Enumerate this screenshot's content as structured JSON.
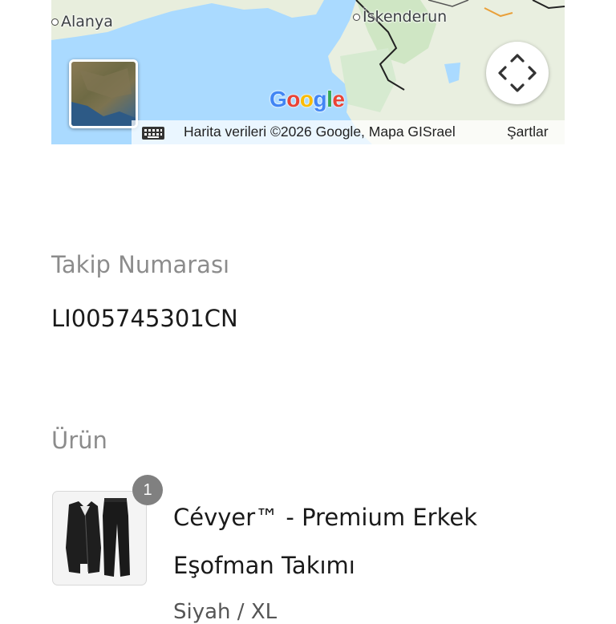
{
  "map": {
    "places": [
      "Alanya",
      "İskenderun"
    ],
    "google_logo_letters": [
      {
        "ch": "G",
        "color": "#4285F4"
      },
      {
        "ch": "o",
        "color": "#EA4335"
      },
      {
        "ch": "o",
        "color": "#FBBC05"
      },
      {
        "ch": "g",
        "color": "#4285F4"
      },
      {
        "ch": "l",
        "color": "#34A853"
      },
      {
        "ch": "e",
        "color": "#EA4335"
      }
    ],
    "attribution": "Harita verileri ©2026 Google, Mapa GISrael",
    "terms": "Şartlar",
    "satellite_icon": "satellite-layer-thumbnail",
    "pan_icon": "pan-arrows-icon",
    "keyboard_icon": "keyboard-icon"
  },
  "tracking": {
    "label": "Takip Numarası",
    "value": "LI005745301CN"
  },
  "product_section": {
    "label": "Ürün",
    "item": {
      "quantity": "1",
      "title": "Cévyer™ - Premium Erkek Eşofman Takımı",
      "variant": "Siyah / XL"
    }
  }
}
